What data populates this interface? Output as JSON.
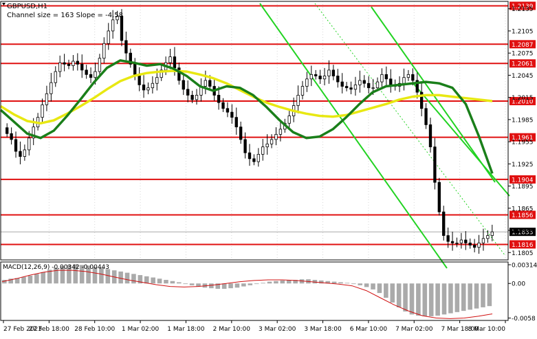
{
  "header": {
    "symbol": "GBPUSD,H1",
    "indicator_label": "Channel size = 163 Slope = -4.58"
  },
  "chart_data": [
    {
      "type": "candlestick",
      "title": "GBPUSD,H1",
      "x_ticks": [
        "27 Feb 2023",
        "27 Feb 18:00",
        "28 Feb 10:00",
        "1 Mar 02:00",
        "1 Mar 18:00",
        "2 Mar 10:00",
        "3 Mar 02:00",
        "3 Mar 18:00",
        "6 Mar 10:00",
        "7 Mar 02:00",
        "7 Mar 18:00",
        "8 Mar 10:00"
      ],
      "ylim": [
        1.1795,
        1.2145
      ],
      "y_ticks": [
        1.2135,
        1.2105,
        1.2075,
        1.2045,
        1.2015,
        1.1985,
        1.1955,
        1.1925,
        1.1895,
        1.1865,
        1.1835,
        1.1805
      ],
      "level_lines": [
        1.2139,
        1.2087,
        1.2061,
        1.201,
        1.1961,
        1.1904,
        1.1856,
        1.1816
      ],
      "current_price": 1.1833,
      "close_series": [
        1.1966,
        1.1958,
        1.1942,
        1.1935,
        1.1944,
        1.196,
        1.1975,
        1.1988,
        1.2005,
        1.202,
        1.2035,
        1.205,
        1.2062,
        1.206,
        1.2058,
        1.2064,
        1.206,
        1.2052,
        1.2046,
        1.2042,
        1.205,
        1.2068,
        1.2088,
        1.2105,
        1.212,
        1.2125,
        1.2092,
        1.2075,
        1.206,
        1.2045,
        1.2032,
        1.2025,
        1.2028,
        1.2034,
        1.2042,
        1.2052,
        1.2062,
        1.207,
        1.2055,
        1.2038,
        1.2026,
        1.2018,
        1.2012,
        1.2018,
        1.203,
        1.2038,
        1.203,
        1.2018,
        1.2008,
        1.2,
        1.1995,
        1.1988,
        1.1975,
        1.1958,
        1.194,
        1.1932,
        1.1928,
        1.1938,
        1.1948,
        1.1952,
        1.1958,
        1.1965,
        1.1972,
        1.198,
        1.199,
        1.2004,
        1.2018,
        1.203,
        1.204,
        1.2046,
        1.2044,
        1.204,
        1.2044,
        1.2052,
        1.2044,
        1.2036,
        1.203,
        1.2028,
        1.2026,
        1.2032,
        1.2038,
        1.2034,
        1.2028,
        1.2028,
        1.2036,
        1.2046,
        1.204,
        1.2032,
        1.203,
        1.2034,
        1.2042,
        1.2046,
        1.2038,
        1.2022,
        1.2,
        1.1978,
        1.1948,
        1.19,
        1.186,
        1.1828,
        1.182,
        1.1818,
        1.1818,
        1.1822,
        1.1818,
        1.1815,
        1.1812,
        1.1818,
        1.1824,
        1.1828,
        1.1833
      ],
      "moving_averages": [
        {
          "color": "#e8e812",
          "values": [
            1.2003,
            1.1992,
            1.1983,
            1.198,
            1.1984,
            1.1993,
            1.2003,
            1.2014,
            1.2026,
            1.2037,
            1.2044,
            1.2048,
            1.205,
            1.2051,
            1.205,
            1.2046,
            1.2041,
            1.2034,
            1.2025,
            1.2016,
            1.2008,
            1.2002,
            1.1997,
            1.1993,
            1.199,
            1.1989,
            1.1991,
            1.1996,
            1.2001,
            1.2006,
            1.2012,
            1.2016,
            1.2018,
            1.2018,
            1.2016,
            1.2014,
            1.2012,
            1.201
          ]
        },
        {
          "color": "#1a7f1a",
          "values": [
            1.1998,
            1.1982,
            1.1966,
            1.196,
            1.197,
            1.199,
            1.2012,
            1.2035,
            1.2055,
            1.2065,
            1.2062,
            1.2058,
            1.206,
            1.2054,
            1.2044,
            1.203,
            1.2024,
            1.203,
            1.2028,
            1.2018,
            1.2002,
            1.1984,
            1.1968,
            1.196,
            1.1962,
            1.1972,
            1.1988,
            1.2006,
            1.2022,
            1.203,
            1.2032,
            1.2034,
            1.2036,
            1.2034,
            1.2028,
            1.2006,
            1.1962,
            1.1912
          ]
        }
      ]
    },
    {
      "type": "histogram",
      "label": "MACD(12,26,9) -0.00342 -0.00443",
      "ylim": [
        -0.0062,
        0.0036
      ],
      "y_ticks": [
        0.00314,
        0.0,
        -0.0058
      ],
      "values": [
        0.0006,
        0.0008,
        0.0009,
        0.0011,
        0.0013,
        0.0016,
        0.0019,
        0.0023,
        0.0026,
        0.0029,
        0.0031,
        0.0032,
        0.0031,
        0.003,
        0.0028,
        0.0026,
        0.0024,
        0.0022,
        0.002,
        0.0018,
        0.0016,
        0.0014,
        0.0012,
        0.001,
        0.0008,
        0.0006,
        0.0004,
        0.0002,
        -0.0001,
        -0.0003,
        -0.0005,
        -0.0007,
        -0.0008,
        -0.0009,
        -0.0009,
        -0.0008,
        -0.0007,
        -0.0005,
        -0.0003,
        -0.0001,
        0.0001,
        0.0003,
        0.0004,
        0.0005,
        0.0006,
        0.0006,
        0.0007,
        0.0007,
        0.0006,
        0.0005,
        0.0004,
        0.0003,
        0.0002,
        0.0001,
        -0.0001,
        -0.0003,
        -0.0006,
        -0.001,
        -0.0016,
        -0.0024,
        -0.0032,
        -0.004,
        -0.0047,
        -0.0052,
        -0.0054,
        -0.0055,
        -0.0055,
        -0.0054,
        -0.0052,
        -0.005,
        -0.0048,
        -0.0046,
        -0.0044,
        -0.0042,
        -0.004,
        -0.0038
      ],
      "signal_values": [
        0.0003,
        0.0008,
        0.0014,
        0.0019,
        0.0022,
        0.0022,
        0.002,
        0.0016,
        0.0011,
        0.0006,
        0.0002,
        -0.0002,
        -0.0005,
        -0.0006,
        -0.0005,
        -0.0003,
        0.0,
        0.0003,
        0.0005,
        0.0006,
        0.0006,
        0.0005,
        0.0003,
        0.0001,
        -0.0001,
        -0.0004,
        -0.0012,
        -0.0024,
        -0.0036,
        -0.0046,
        -0.0054,
        -0.0058,
        -0.0059,
        -0.0058,
        -0.0055,
        -0.0051
      ],
      "signal_color": "#d01010"
    }
  ],
  "style": {
    "level_color": "#e01010",
    "channel_color": "#22d322",
    "candle_color": "#000000",
    "macd_bar_color": "#aaaaaa"
  }
}
